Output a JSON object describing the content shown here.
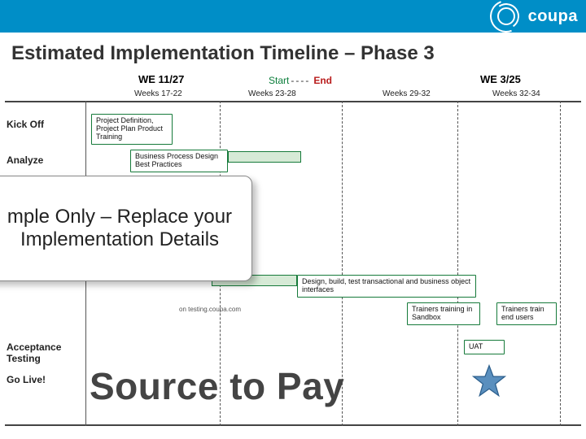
{
  "brand": "coupa",
  "title": "Estimated Implementation Timeline – Phase 3",
  "header": {
    "we1": "WE 11/27",
    "we2": "WE 3/25",
    "start": "Start",
    "dash": "----",
    "end": "End",
    "weeks": [
      "Weeks 17-22",
      "Weeks 23-28",
      "Weeks 29-32",
      "Weeks 32-34"
    ]
  },
  "rows": {
    "kickoff": "Kick Off",
    "analyze": "Analyze",
    "acceptance": "Acceptance Testing",
    "golive": "Go Live!"
  },
  "tasks": {
    "projdef": "Project Definition, Project Plan Product Training",
    "bpd": "Business Process Design Best Practices",
    "dbti": "Design, build, test transactional and business object interfaces",
    "tts": "Trainers training in Sandbox",
    "tte": "Trainers train end users",
    "uat": "UAT",
    "mini": "on testing.coupa.com"
  },
  "overlay": "mple Only – Replace your Implementation Details",
  "banner": "Source to Pay"
}
